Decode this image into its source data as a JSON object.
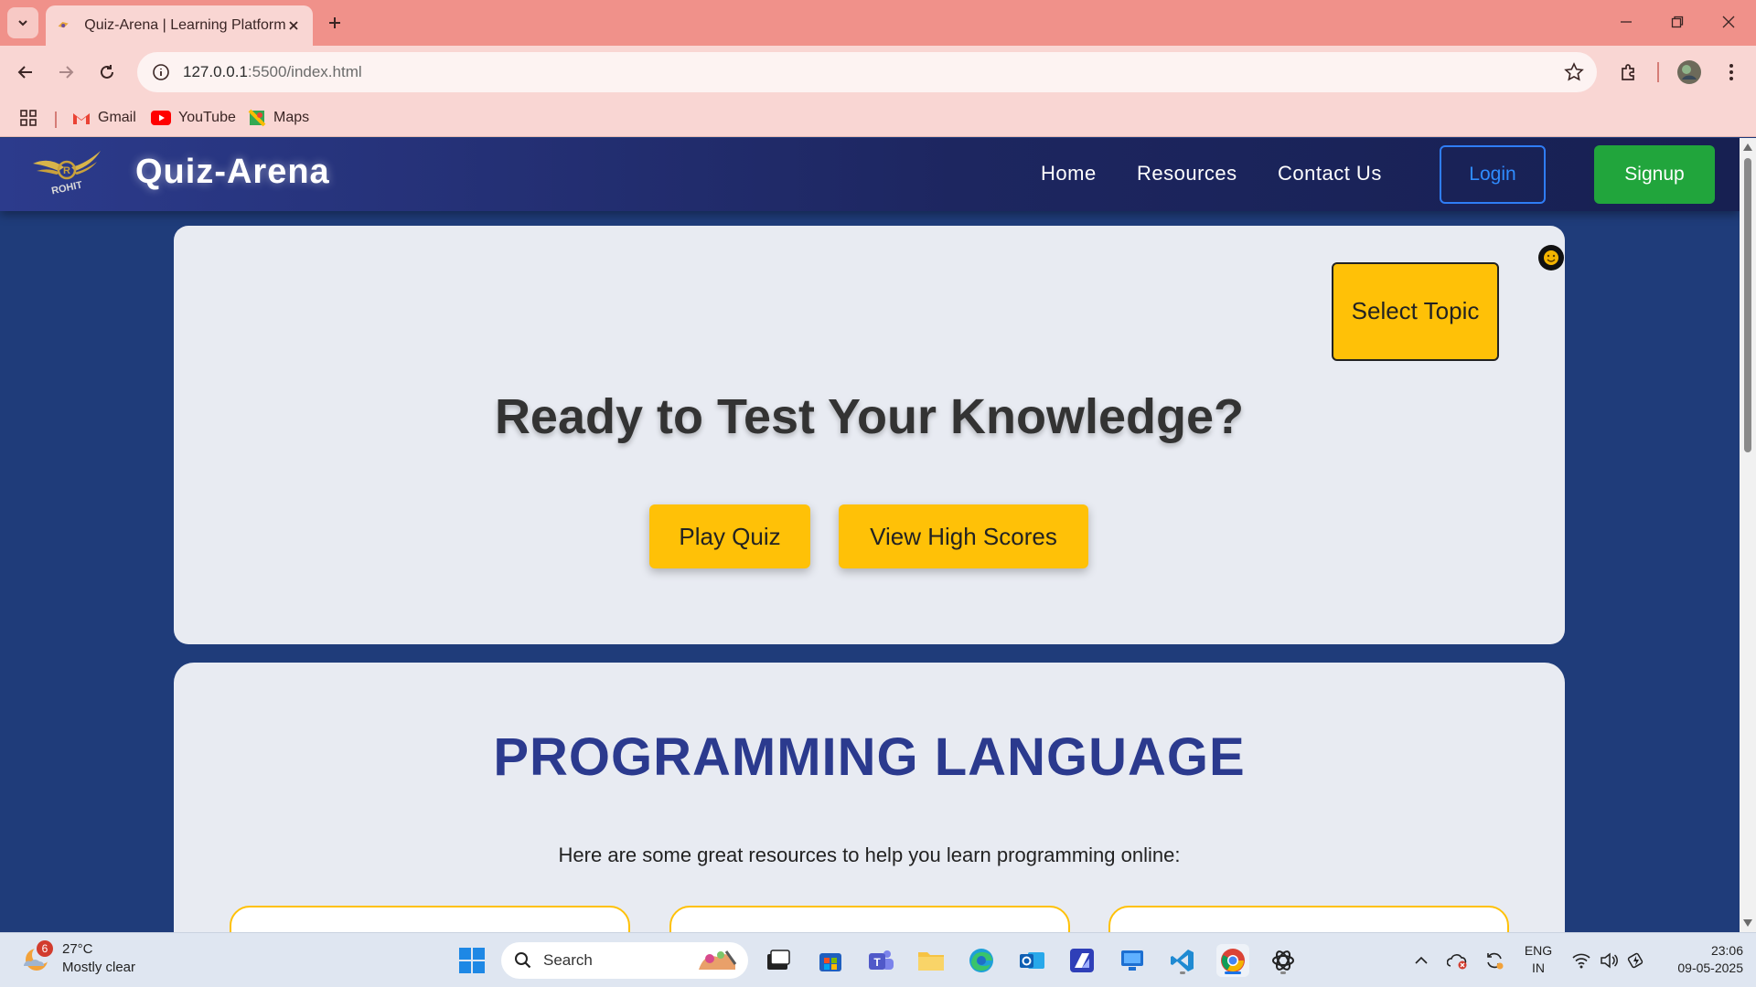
{
  "browser": {
    "tab_title": "Quiz-Arena | Learning Platform",
    "url_host": "127.0.0.1",
    "url_path": ":5500/index.html",
    "bookmarks": [
      "Gmail",
      "YouTube",
      "Maps"
    ]
  },
  "site": {
    "brand": "Quiz-Arena",
    "logo_text": "ROHIT",
    "nav": [
      "Home",
      "Resources",
      "Contact Us"
    ],
    "login_label": "Login",
    "signup_label": "Signup"
  },
  "hero": {
    "select_topic_label": "Select Topic",
    "title": "Ready to Test Your Knowledge?",
    "play_label": "Play Quiz",
    "scores_label": "View High Scores"
  },
  "resources": {
    "title": "PROGRAMMING LANGUAGE",
    "subtitle": "Here are some great resources to help you learn programming online:"
  },
  "taskbar": {
    "weather_temp": "27°C",
    "weather_desc": "Mostly clear",
    "weather_badge": "6",
    "search_placeholder": "Search",
    "lang_line1": "ENG",
    "lang_line2": "IN",
    "time": "23:06",
    "date": "09-05-2025"
  },
  "colors": {
    "accent_yellow": "#ffc107",
    "signup_green": "#21a53c",
    "login_blue": "#2f8cff",
    "heading_blue": "#2b3a8e",
    "page_bg": "#1f3c7a"
  }
}
